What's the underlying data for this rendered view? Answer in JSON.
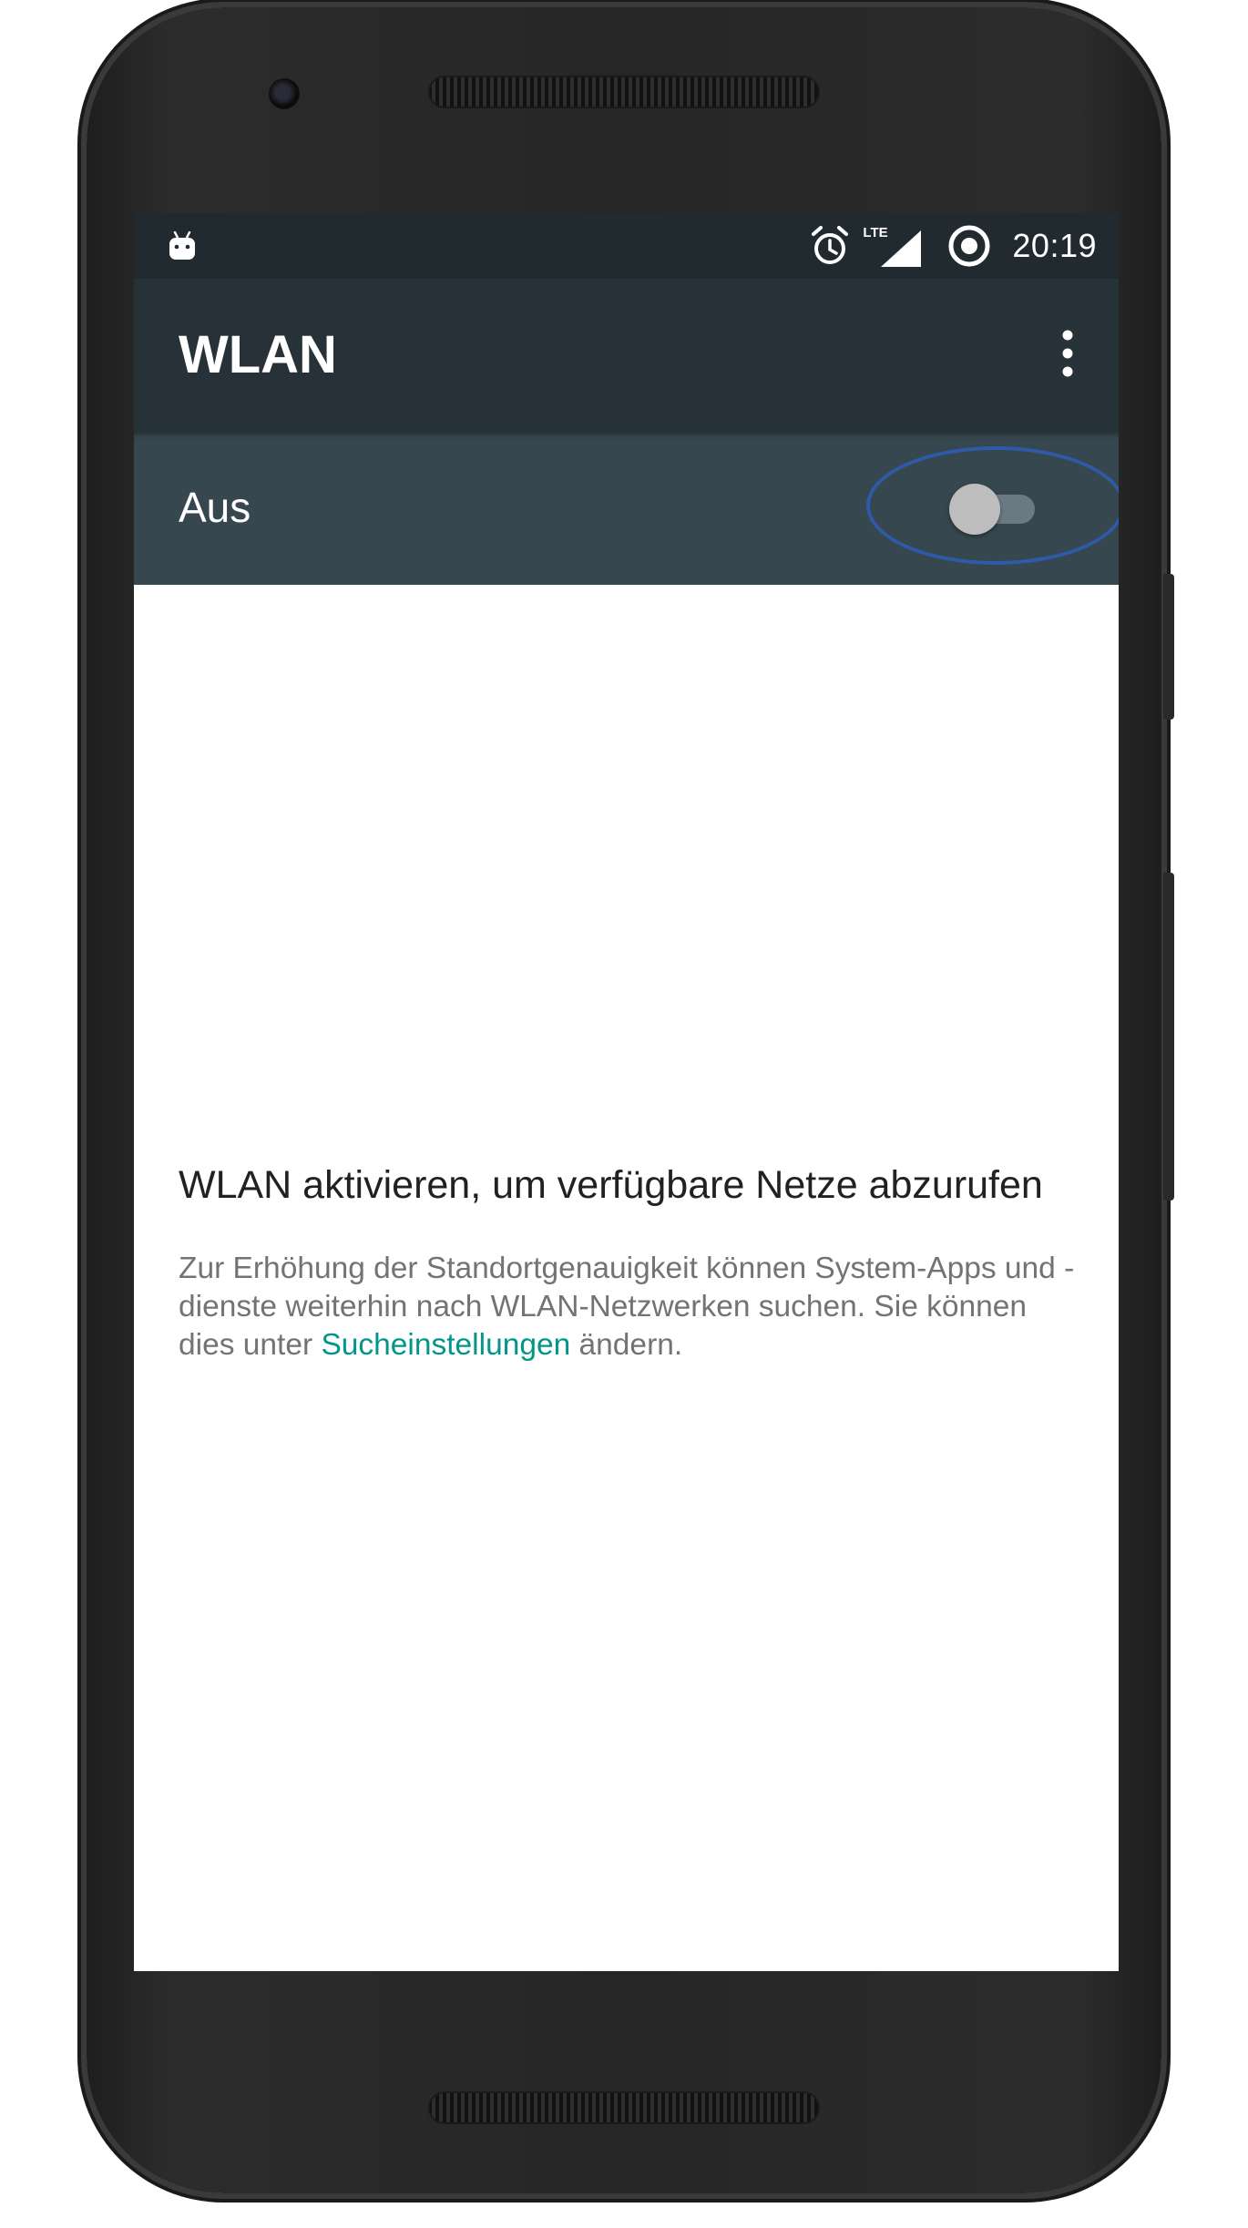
{
  "status_bar": {
    "time": "20:19",
    "network_label": "LTE",
    "icons": [
      "android-notification-icon",
      "alarm-icon",
      "lte-signal-icon",
      "sync-circle-icon"
    ]
  },
  "app_bar": {
    "title": "WLAN",
    "overflow_icon": "more-vert-icon"
  },
  "switch_bar": {
    "label": "Aus",
    "state": "off"
  },
  "empty_state": {
    "headline": "WLAN aktivieren, um verfügbare Netze abzurufen",
    "info_before_link": "Zur Erhöhung der Standortgenauigkeit können System-Apps und -dienste weiterhin nach WLAN-Netzwerken suchen. Sie können dies unter ",
    "info_link": "Sucheinstellungen",
    "info_after_link": " ändern."
  },
  "colors": {
    "status_bar_bg": "#212a2e",
    "app_bar_bg": "#263238",
    "switch_bar_bg": "#37474f",
    "link": "#009688",
    "highlight_ring": "#2f5aa8"
  }
}
